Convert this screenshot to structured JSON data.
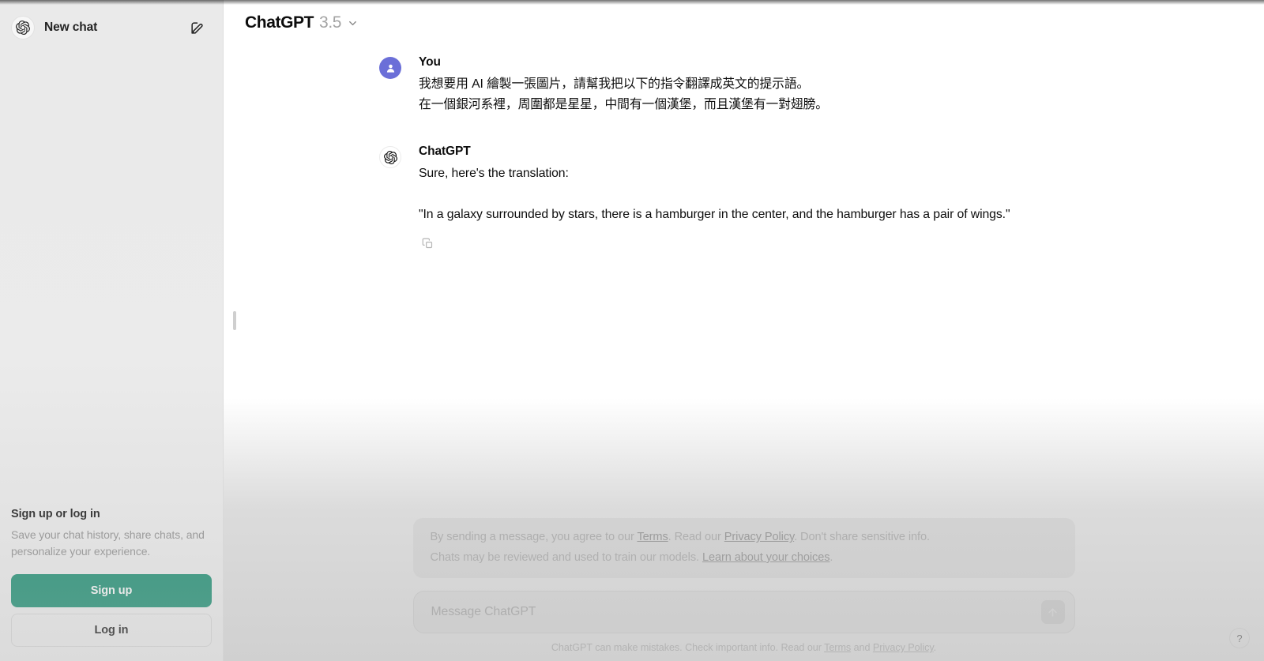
{
  "sidebar": {
    "new_chat_label": "New chat",
    "compose_icon": "compose-icon",
    "logo_icon": "openai-logo-icon",
    "auth": {
      "title": "Sign up or log in",
      "subtitle": "Save your chat history, share chats, and personalize your experience.",
      "signup_label": "Sign up",
      "login_label": "Log in",
      "signup_color": "#0f8b6c"
    }
  },
  "header": {
    "model_name": "ChatGPT",
    "model_version": "3.5",
    "chevron_icon": "chevron-down-icon"
  },
  "conversation": [
    {
      "author": "You",
      "avatar_icon": "user-avatar-icon",
      "lines": [
        "我想要用 AI 繪製一張圖片，請幫我把以下的指令翻譯成英文的提示語。",
        "在一個銀河系裡，周圍都是星星，中間有一個漢堡，而且漢堡有一對翅膀。"
      ]
    },
    {
      "author": "ChatGPT",
      "avatar_icon": "openai-logo-icon",
      "lines": [
        "Sure, here's the translation:",
        "\"In a galaxy surrounded by stars, there is a hamburger in the center, and the hamburger has a pair of wings.\""
      ],
      "copy_icon": "copy-icon"
    }
  ],
  "notice": {
    "line1_a": "By sending a message, you agree to our ",
    "line1_link1": "Terms",
    "line1_b": ". Read our ",
    "line1_link2": "Privacy Policy",
    "line1_c": ". Don't share sensitive info.",
    "line2_a": "Chats may be reviewed and used to train our models. ",
    "line2_link": "Learn about your choices",
    "line2_b": "."
  },
  "composer": {
    "placeholder": "Message ChatGPT",
    "value": "",
    "send_icon": "send-arrow-up-icon"
  },
  "footer": {
    "text_a": "ChatGPT can make mistakes. Check important info. Read our ",
    "link1": "Terms",
    "text_b": " and ",
    "link2": "Privacy Policy",
    "text_c": "."
  },
  "help": {
    "label": "?"
  }
}
